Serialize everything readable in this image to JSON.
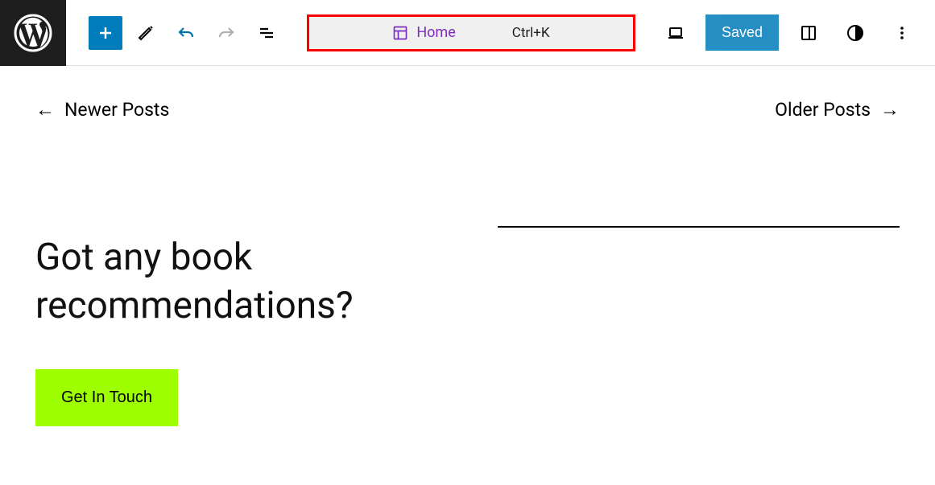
{
  "toolbar": {
    "add_label": "Add",
    "edit_label": "Edit",
    "undo_label": "Undo",
    "redo_label": "Redo",
    "list_label": "Document Overview",
    "device_label": "View",
    "settings_label": "Settings",
    "styles_label": "Styles",
    "options_label": "Options",
    "save_label": "Saved"
  },
  "document_bar": {
    "label": "Home",
    "shortcut": "Ctrl+K"
  },
  "pagination": {
    "newer": "Newer Posts",
    "older": "Older Posts"
  },
  "content": {
    "headline": "Got any book recommendations?",
    "cta": "Get In Touch"
  }
}
